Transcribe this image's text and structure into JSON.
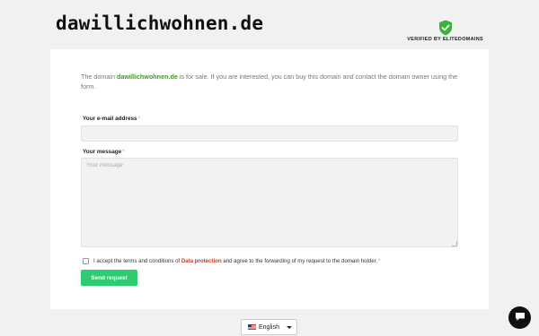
{
  "header": {
    "domain": "dawillichwohnen.de",
    "verified_text": "VERIFIED BY ELITEDOMAINS",
    "shield_icon": "verified-shield-icon",
    "shield_color": "#3bb33b"
  },
  "intro": {
    "before": "The domain ",
    "domain": "dawillichwohnen.de",
    "after": " is for sale. If you are interested, you can buy this domain and contact the domain owner using the form."
  },
  "form": {
    "email_label": "Your e-mail address",
    "message_label": "Your message",
    "required_mark": "*",
    "email_value": "",
    "message_placeholder": "Your message",
    "terms_before": "I accept the terms and conditions of ",
    "terms_link": "Data protection",
    "terms_after": " and agree to the forwarding of my request to the domain holder.",
    "send_label": "Send request",
    "accent_color": "#2ecc71"
  },
  "language": {
    "selected": "English",
    "flag_icon": "us-flag-icon"
  },
  "chat": {
    "icon": "chat-bubble-icon"
  }
}
